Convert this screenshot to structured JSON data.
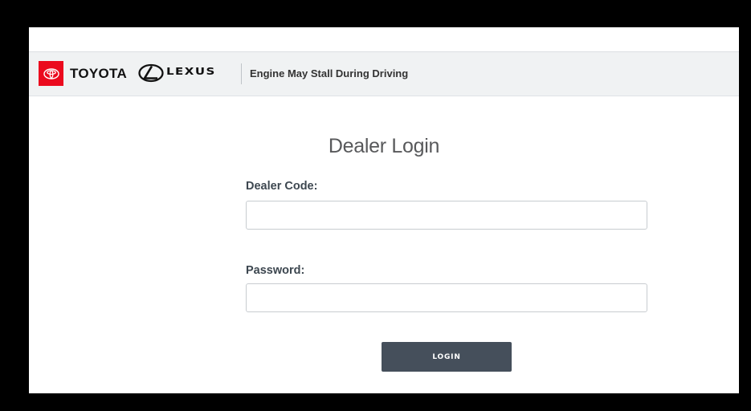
{
  "header": {
    "brand_primary": "TOYOTA",
    "brand_secondary": "LEXUS",
    "recall_title": "Engine May Stall During Driving",
    "colors": {
      "toyota_red": "#eb0a1e",
      "header_bg": "#f0f2f3"
    }
  },
  "login": {
    "title": "Dealer Login",
    "dealer_code_label": "Dealer Code:",
    "dealer_code_value": "",
    "password_label": "Password:",
    "password_value": "",
    "button_label": "LOGIN",
    "colors": {
      "button_bg": "#454f5b",
      "label": "#3d4750"
    }
  },
  "icons": {
    "toyota_logo": "toyota-logo-icon",
    "lexus_logo": "lexus-logo-icon"
  }
}
